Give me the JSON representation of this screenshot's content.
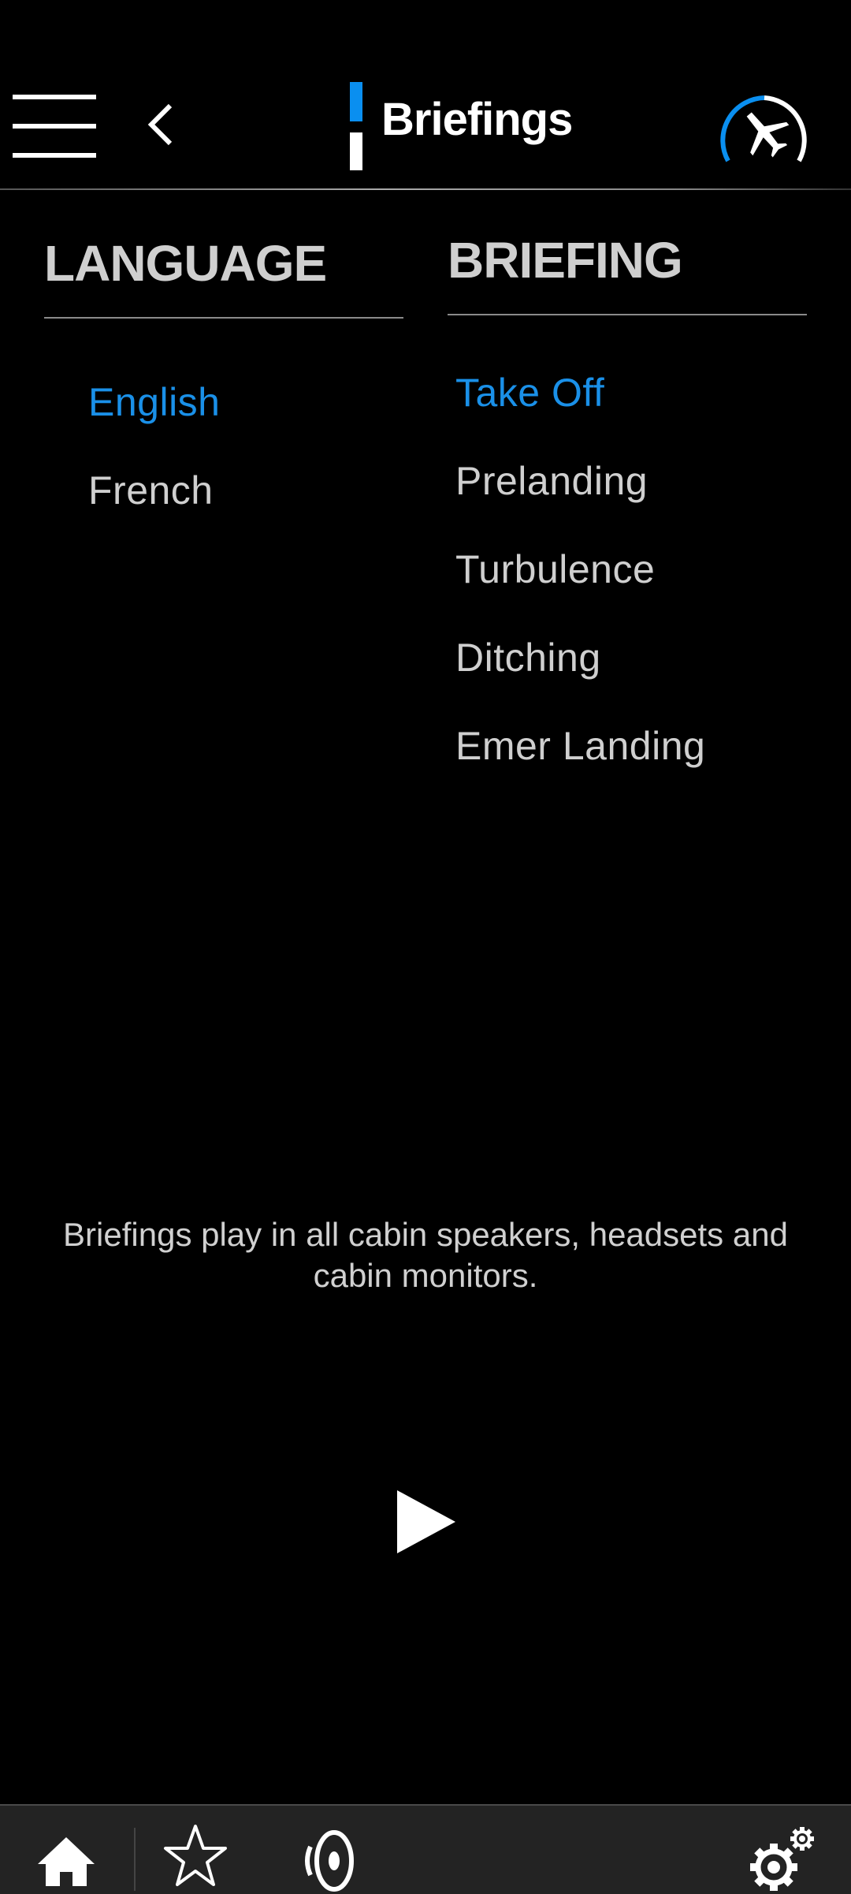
{
  "header": {
    "title": "Briefings",
    "menu_icon": "hamburger-menu-icon",
    "back_icon": "chevron-left-icon",
    "flight_icon": "flight-progress-airplane-icon",
    "flight_progress": 0.4
  },
  "language": {
    "title": "LANGUAGE",
    "items": [
      {
        "label": "English",
        "selected": true
      },
      {
        "label": "French",
        "selected": false
      }
    ]
  },
  "briefing": {
    "title": "BRIEFING",
    "items": [
      {
        "label": "Take Off",
        "selected": true
      },
      {
        "label": "Prelanding",
        "selected": false
      },
      {
        "label": "Turbulence",
        "selected": false
      },
      {
        "label": "Ditching",
        "selected": false
      },
      {
        "label": "Emer Landing",
        "selected": false
      }
    ]
  },
  "note": "Briefings play in all cabin speakers, headsets and cabin monitors.",
  "play_icon": "play-icon",
  "bottom_bar": {
    "items": [
      "home-icon",
      "star-icon",
      "speaker-icon",
      "settings-gears-icon"
    ]
  },
  "colors": {
    "accent": "#1a90e8",
    "background": "#000000",
    "bottom_bar": "#232323",
    "text": "#d0d0d0"
  }
}
